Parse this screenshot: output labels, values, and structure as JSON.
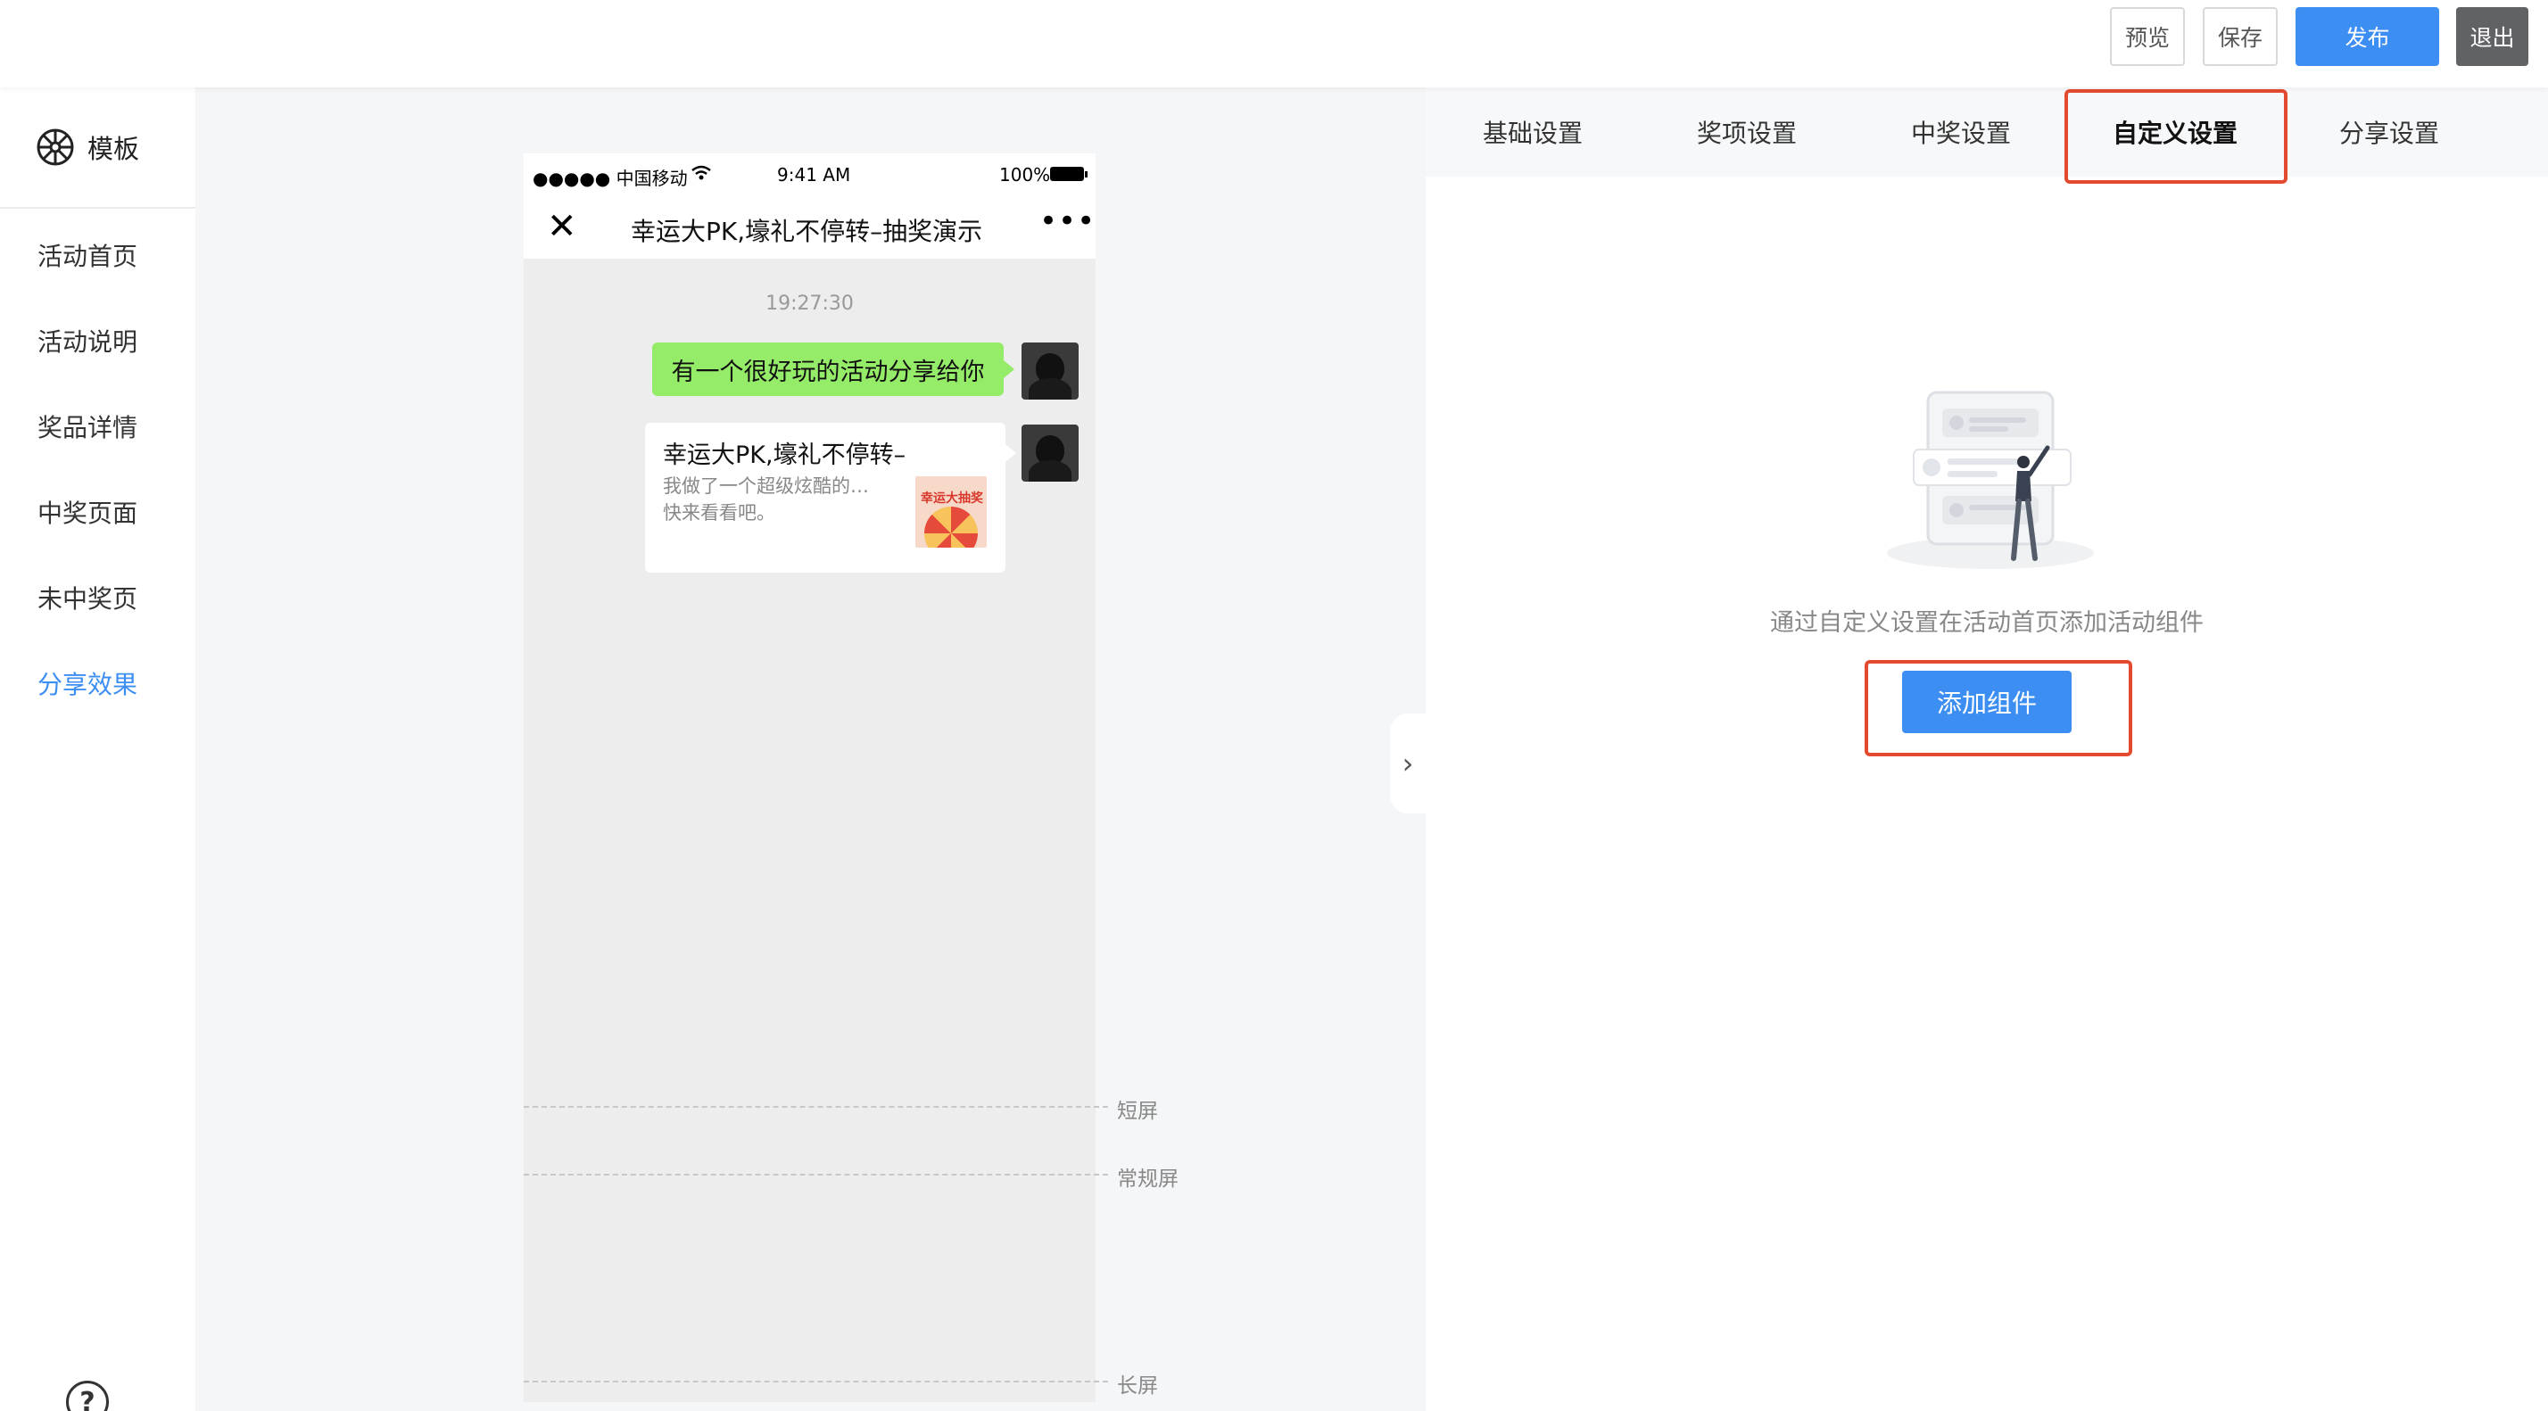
{
  "toolbar": {
    "preview_label": "预览",
    "save_label": "保存",
    "publish_label": "发布",
    "exit_label": "退出"
  },
  "sidebar": {
    "brand_label": "模板",
    "items": [
      {
        "label": "活动首页"
      },
      {
        "label": "活动说明"
      },
      {
        "label": "奖品详情"
      },
      {
        "label": "中奖页面"
      },
      {
        "label": "未中奖页"
      },
      {
        "label": "分享效果",
        "active": true
      }
    ],
    "help_label": "?"
  },
  "phone": {
    "status": {
      "carrier": "●●●●● 中国移动",
      "time": "9:41 AM",
      "battery": "100%"
    },
    "nav": {
      "close_glyph": "✕",
      "title": "幸运大PK,壕礼不停转–抽奖演示",
      "more_glyph": "•••"
    },
    "chat": {
      "time": "19:27:30",
      "message": "有一个很好玩的活动分享给你",
      "card": {
        "title": "幸运大PK,壕礼不停转–",
        "desc_line1": "我做了一个超级炫酷的…",
        "desc_line2": "快来看看吧。",
        "thumb_text": "幸运大抽奖"
      }
    }
  },
  "guides": {
    "short": "短屏",
    "normal": "常规屏",
    "long": "长屏"
  },
  "collapse_glyph": "›",
  "panel": {
    "tabs": [
      {
        "label": "基础设置"
      },
      {
        "label": "奖项设置"
      },
      {
        "label": "中奖设置"
      },
      {
        "label": "自定义设置",
        "active": true
      },
      {
        "label": "分享设置"
      }
    ],
    "empty_text": "通过自定义设置在活动首页添加活动组件",
    "add_button_label": "添加组件"
  },
  "colors": {
    "primary": "#3d8ef2",
    "highlight": "#e34a2f",
    "chat_green": "#95ec69"
  }
}
